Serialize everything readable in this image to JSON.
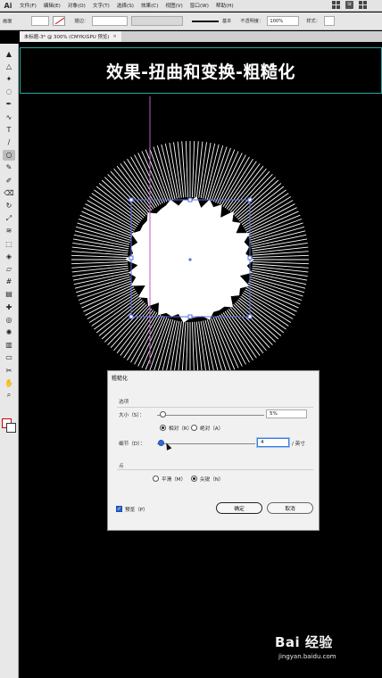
{
  "app": {
    "logo": "Ai",
    "menus": [
      "文件(F)",
      "编辑(E)",
      "对象(O)",
      "文字(T)",
      "选择(S)",
      "效果(C)",
      "视图(V)",
      "窗口(W)",
      "帮助(H)"
    ],
    "right_icon_label": "St"
  },
  "controlbar": {
    "doc_label": "画面",
    "stroke_label": "描边：",
    "stroke_style": "基本",
    "opacity_label": "不透明度：",
    "opacity_value": "100%",
    "style_label": "样式："
  },
  "document": {
    "tab_title": "未标题-3* @ 300% (CMYK/GPU 预览)",
    "close_glyph": "×"
  },
  "banner": {
    "title": "效果-扭曲和变换-粗糙化"
  },
  "dialog": {
    "title": "粗糙化",
    "options_group": "选项",
    "size_label": "大小（S）：",
    "size_value": "5%",
    "size_fraction": 0.05,
    "relative_label": "相对（R）",
    "absolute_label": "绝对（A）",
    "size_mode": "relative",
    "detail_label": "细节（D）：",
    "detail_value": "4",
    "detail_fraction": 0.04,
    "detail_unit": "/ 英寸",
    "points_group": "点",
    "smooth_label": "平滑（M）",
    "corner_label": "尖锐（N）",
    "points_mode": "corner",
    "preview_label": "预览（P）",
    "preview_checked": true,
    "ok_label": "确定",
    "cancel_label": "取消"
  },
  "watermark": {
    "brand": "Bai 经验",
    "url": "jingyan.baidu.com"
  },
  "colors": {
    "banner_border": "#25a7a6",
    "selection": "#5b6fd6",
    "guide": "#c05bb8",
    "accent": "#2f6bd6"
  },
  "icons": [
    "selection-tool-icon",
    "direct-selection-icon",
    "magic-wand-icon",
    "lasso-icon",
    "pen-icon",
    "curvature-icon",
    "type-icon",
    "line-icon",
    "ellipse-icon",
    "paintbrush-icon",
    "shaper-icon",
    "eraser-icon",
    "rotate-icon",
    "scale-icon",
    "width-icon",
    "free-transform-icon",
    "shape-builder-icon",
    "perspective-icon",
    "mesh-icon",
    "gradient-icon",
    "eyedropper-icon",
    "blend-icon",
    "symbol-sprayer-icon",
    "graph-icon",
    "artboard-icon",
    "slice-icon",
    "hand-icon",
    "zoom-icon"
  ]
}
